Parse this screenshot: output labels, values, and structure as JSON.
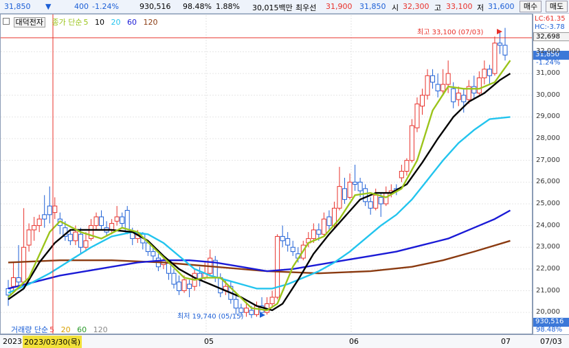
{
  "header": {
    "price": "31,850",
    "change_arrow": "▼",
    "change": "400",
    "change_pct": "-1.24%",
    "volume": "930,516",
    "ratio1": "98.48%",
    "ratio2": "1.88%",
    "amount": "30,015백만",
    "ask_label": "최우선",
    "ask": "31,900",
    "bid": "31,850",
    "open_label": "시",
    "open": "32,300",
    "high_label": "고",
    "high": "33,100",
    "low_label": "저",
    "low": "31,600",
    "buy_button": "매수",
    "sell_button": "매도"
  },
  "legend": {
    "stock_name": "대덕전자",
    "ma_label": "종가 단순",
    "ma5": "5",
    "ma10": "10",
    "ma20": "20",
    "ma60": "60",
    "ma120": "120"
  },
  "scale": {
    "lc": "LC:61.35",
    "hc": "HC:-3.78",
    "highlight_top": "32,698",
    "current": "31,850",
    "current_pct": "-1.24%",
    "ticks": [
      "32,000",
      "31,000",
      "30,000",
      "29,000",
      "28,000",
      "27,000",
      "26,000",
      "25,000",
      "24,000",
      "23,000",
      "22,000",
      "21,000",
      "20,000"
    ],
    "volume_box": "930,516",
    "volume_pct": "98.48%"
  },
  "annotations": {
    "high": "최고 33,100 (07/03)",
    "low": "최저 19,740 (05/15)"
  },
  "volume_legend": {
    "label": "거래량 단순",
    "ma5": "5",
    "ma20": "20",
    "ma60": "60",
    "ma120": "120"
  },
  "xaxis": {
    "year": "2023",
    "cursor_date": "2023/03/30(목)",
    "m05": "05",
    "m06": "06",
    "m07": "07",
    "right": "07/03"
  },
  "colors": {
    "up": "#e8302a",
    "down": "#1c5fd6",
    "ma5": "#9bc41a",
    "ma10": "#000000",
    "ma20": "#22c4ee",
    "ma60": "#1a1ad6",
    "ma120": "#8a3a10"
  },
  "chart_data": {
    "type": "candlestick",
    "ylim": [
      19500,
      33500
    ],
    "candles": [
      {
        "o": 21100,
        "c": 20800,
        "h": 21500,
        "l": 20300
      },
      {
        "o": 21200,
        "c": 21600,
        "h": 22300,
        "l": 21000
      },
      {
        "o": 21600,
        "c": 21400,
        "h": 23100,
        "l": 21200
      },
      {
        "o": 21400,
        "c": 23000,
        "h": 24800,
        "l": 21300
      },
      {
        "o": 23100,
        "c": 23800,
        "h": 24100,
        "l": 22800
      },
      {
        "o": 23800,
        "c": 24000,
        "h": 24400,
        "l": 23300
      },
      {
        "o": 24000,
        "c": 24300,
        "h": 24500,
        "l": 23700
      },
      {
        "o": 24500,
        "c": 24300,
        "h": 25400,
        "l": 23900
      },
      {
        "o": 24900,
        "c": 24500,
        "h": 25800,
        "l": 24100
      },
      {
        "o": 24600,
        "c": 24900,
        "h": 25300,
        "l": 24300
      },
      {
        "o": 24300,
        "c": 24000,
        "h": 24600,
        "l": 23600
      },
      {
        "o": 23900,
        "c": 23500,
        "h": 24200,
        "l": 23300
      },
      {
        "o": 23600,
        "c": 23300,
        "h": 23800,
        "l": 23100
      },
      {
        "o": 23300,
        "c": 23700,
        "h": 24000,
        "l": 23100
      },
      {
        "o": 23600,
        "c": 23000,
        "h": 23900,
        "l": 22700
      },
      {
        "o": 23000,
        "c": 23300,
        "h": 23700,
        "l": 22800
      },
      {
        "o": 23400,
        "c": 24000,
        "h": 24300,
        "l": 23300
      },
      {
        "o": 24000,
        "c": 24400,
        "h": 24600,
        "l": 23800
      },
      {
        "o": 24400,
        "c": 24000,
        "h": 24700,
        "l": 23800
      },
      {
        "o": 23900,
        "c": 23700,
        "h": 24200,
        "l": 23500
      },
      {
        "o": 23800,
        "c": 24100,
        "h": 24300,
        "l": 23600
      },
      {
        "o": 24200,
        "c": 24400,
        "h": 24900,
        "l": 24000
      },
      {
        "o": 24400,
        "c": 24100,
        "h": 24600,
        "l": 23900
      },
      {
        "o": 24700,
        "c": 23700,
        "h": 24900,
        "l": 23600
      },
      {
        "o": 23700,
        "c": 23400,
        "h": 23900,
        "l": 23100
      },
      {
        "o": 23400,
        "c": 23600,
        "h": 23800,
        "l": 23200
      },
      {
        "o": 23600,
        "c": 23200,
        "h": 23700,
        "l": 22900
      },
      {
        "o": 23200,
        "c": 22800,
        "h": 23300,
        "l": 22600
      },
      {
        "o": 22800,
        "c": 22600,
        "h": 23000,
        "l": 22400
      },
      {
        "o": 22500,
        "c": 22100,
        "h": 22700,
        "l": 21900
      },
      {
        "o": 22200,
        "c": 22400,
        "h": 22600,
        "l": 22000
      },
      {
        "o": 22300,
        "c": 21800,
        "h": 22400,
        "l": 21500
      },
      {
        "o": 21800,
        "c": 21300,
        "h": 22000,
        "l": 21100
      },
      {
        "o": 21400,
        "c": 21000,
        "h": 21700,
        "l": 20800
      },
      {
        "o": 21000,
        "c": 21500,
        "h": 21700,
        "l": 20900
      },
      {
        "o": 21300,
        "c": 21100,
        "h": 21500,
        "l": 20700
      },
      {
        "o": 21200,
        "c": 21800,
        "h": 22000,
        "l": 21000
      },
      {
        "o": 21800,
        "c": 21500,
        "h": 22100,
        "l": 21200
      },
      {
        "o": 21600,
        "c": 21800,
        "h": 22300,
        "l": 21500
      },
      {
        "o": 21800,
        "c": 22500,
        "h": 22900,
        "l": 21700
      },
      {
        "o": 22400,
        "c": 21600,
        "h": 22600,
        "l": 21400
      },
      {
        "o": 21600,
        "c": 20900,
        "h": 21800,
        "l": 20700
      },
      {
        "o": 21000,
        "c": 21200,
        "h": 21500,
        "l": 20800
      },
      {
        "o": 21200,
        "c": 20600,
        "h": 21400,
        "l": 20400
      },
      {
        "o": 20600,
        "c": 20200,
        "h": 20800,
        "l": 19900
      },
      {
        "o": 20200,
        "c": 20000,
        "h": 20400,
        "l": 19800
      },
      {
        "o": 20000,
        "c": 20200,
        "h": 20500,
        "l": 19800
      },
      {
        "o": 20100,
        "c": 19900,
        "h": 20300,
        "l": 19740
      },
      {
        "o": 19900,
        "c": 20300,
        "h": 20500,
        "l": 19800
      },
      {
        "o": 20300,
        "c": 20000,
        "h": 20700,
        "l": 19900
      },
      {
        "o": 20000,
        "c": 20400,
        "h": 20700,
        "l": 19900
      },
      {
        "o": 20400,
        "c": 20700,
        "h": 21000,
        "l": 20200
      },
      {
        "o": 20700,
        "c": 23500,
        "h": 23600,
        "l": 20600
      },
      {
        "o": 23500,
        "c": 23300,
        "h": 24000,
        "l": 23000
      },
      {
        "o": 23400,
        "c": 23100,
        "h": 23700,
        "l": 22800
      },
      {
        "o": 23000,
        "c": 22800,
        "h": 23300,
        "l": 22600
      },
      {
        "o": 22700,
        "c": 22500,
        "h": 23000,
        "l": 22300
      },
      {
        "o": 22500,
        "c": 23100,
        "h": 23300,
        "l": 22400
      },
      {
        "o": 23200,
        "c": 23400,
        "h": 23700,
        "l": 23000
      },
      {
        "o": 23400,
        "c": 23800,
        "h": 24100,
        "l": 23200
      },
      {
        "o": 23800,
        "c": 23600,
        "h": 24100,
        "l": 23300
      },
      {
        "o": 23600,
        "c": 24300,
        "h": 24600,
        "l": 23500
      },
      {
        "o": 24400,
        "c": 24000,
        "h": 24700,
        "l": 23800
      },
      {
        "o": 24000,
        "c": 24800,
        "h": 25100,
        "l": 23900
      },
      {
        "o": 24800,
        "c": 25800,
        "h": 26700,
        "l": 24700
      },
      {
        "o": 25700,
        "c": 25200,
        "h": 26200,
        "l": 25000
      },
      {
        "o": 25300,
        "c": 26000,
        "h": 26400,
        "l": 25200
      },
      {
        "o": 26000,
        "c": 25900,
        "h": 26800,
        "l": 25600
      },
      {
        "o": 26000,
        "c": 25600,
        "h": 26200,
        "l": 25300
      },
      {
        "o": 25700,
        "c": 25100,
        "h": 25900,
        "l": 24900
      },
      {
        "o": 25100,
        "c": 24800,
        "h": 25300,
        "l": 24500
      },
      {
        "o": 24800,
        "c": 25400,
        "h": 25700,
        "l": 24700
      },
      {
        "o": 25300,
        "c": 25000,
        "h": 25500,
        "l": 24400
      },
      {
        "o": 25000,
        "c": 25500,
        "h": 25800,
        "l": 24900
      },
      {
        "o": 25500,
        "c": 25600,
        "h": 25900,
        "l": 25300
      },
      {
        "o": 25700,
        "c": 25600,
        "h": 25900,
        "l": 25400
      },
      {
        "o": 26200,
        "c": 26500,
        "h": 26800,
        "l": 26000
      },
      {
        "o": 26500,
        "c": 27000,
        "h": 27100,
        "l": 26300
      },
      {
        "o": 27000,
        "c": 28600,
        "h": 28900,
        "l": 26900
      },
      {
        "o": 28500,
        "c": 29600,
        "h": 29900,
        "l": 28300
      },
      {
        "o": 29500,
        "c": 30000,
        "h": 30300,
        "l": 29100
      },
      {
        "o": 30000,
        "c": 30900,
        "h": 31200,
        "l": 29800
      },
      {
        "o": 30900,
        "c": 30600,
        "h": 31200,
        "l": 30300
      },
      {
        "o": 30500,
        "c": 30200,
        "h": 31000,
        "l": 29900
      },
      {
        "o": 30200,
        "c": 30500,
        "h": 31200,
        "l": 30000
      },
      {
        "o": 30500,
        "c": 31000,
        "h": 31600,
        "l": 30100
      },
      {
        "o": 30300,
        "c": 29700,
        "h": 30600,
        "l": 29400
      },
      {
        "o": 29800,
        "c": 30100,
        "h": 30400,
        "l": 29500
      },
      {
        "o": 30000,
        "c": 29700,
        "h": 30300,
        "l": 29200
      },
      {
        "o": 29800,
        "c": 30400,
        "h": 30700,
        "l": 29600
      },
      {
        "o": 30400,
        "c": 30100,
        "h": 30900,
        "l": 29800
      },
      {
        "o": 30100,
        "c": 30800,
        "h": 31100,
        "l": 30000
      },
      {
        "o": 30800,
        "c": 31200,
        "h": 31600,
        "l": 30500
      },
      {
        "o": 31200,
        "c": 30900,
        "h": 31400,
        "l": 30500
      },
      {
        "o": 31000,
        "c": 32400,
        "h": 32700,
        "l": 30900
      },
      {
        "o": 32400,
        "c": 32300,
        "h": 32900,
        "l": 31900
      },
      {
        "o": 32300,
        "c": 31850,
        "h": 33100,
        "l": 31600
      }
    ],
    "ma5": [
      [
        0,
        20700
      ],
      [
        4,
        21600
      ],
      [
        8,
        23700
      ],
      [
        10,
        24200
      ],
      [
        14,
        23700
      ],
      [
        18,
        23400
      ],
      [
        22,
        23900
      ],
      [
        25,
        23700
      ],
      [
        28,
        23000
      ],
      [
        31,
        22300
      ],
      [
        34,
        21600
      ],
      [
        36,
        21500
      ],
      [
        38,
        21600
      ],
      [
        41,
        21600
      ],
      [
        44,
        20900
      ],
      [
        47,
        20200
      ],
      [
        50,
        20100
      ],
      [
        52,
        20400
      ],
      [
        55,
        22100
      ],
      [
        58,
        23200
      ],
      [
        61,
        23500
      ],
      [
        64,
        24300
      ],
      [
        67,
        25400
      ],
      [
        70,
        25500
      ],
      [
        73,
        25300
      ],
      [
        76,
        25700
      ],
      [
        79,
        27000
      ],
      [
        82,
        29300
      ],
      [
        85,
        30400
      ],
      [
        88,
        30300
      ],
      [
        91,
        30300
      ],
      [
        94,
        30600
      ],
      [
        97,
        31600
      ]
    ],
    "ma10": [
      [
        0,
        20600
      ],
      [
        3,
        21100
      ],
      [
        6,
        22300
      ],
      [
        9,
        23200
      ],
      [
        12,
        23800
      ],
      [
        16,
        23800
      ],
      [
        20,
        23800
      ],
      [
        24,
        23700
      ],
      [
        27,
        23300
      ],
      [
        30,
        22600
      ],
      [
        33,
        22000
      ],
      [
        36,
        21600
      ],
      [
        39,
        21300
      ],
      [
        42,
        21000
      ],
      [
        45,
        20700
      ],
      [
        48,
        20300
      ],
      [
        51,
        20100
      ],
      [
        53,
        20400
      ],
      [
        56,
        21500
      ],
      [
        59,
        22700
      ],
      [
        62,
        23600
      ],
      [
        65,
        24400
      ],
      [
        68,
        25200
      ],
      [
        71,
        25500
      ],
      [
        74,
        25500
      ],
      [
        77,
        25900
      ],
      [
        80,
        26900
      ],
      [
        83,
        28000
      ],
      [
        86,
        29000
      ],
      [
        89,
        29700
      ],
      [
        92,
        30100
      ],
      [
        95,
        30700
      ],
      [
        97,
        31000
      ]
    ],
    "ma20": [
      [
        0,
        20900
      ],
      [
        4,
        21300
      ],
      [
        8,
        21800
      ],
      [
        12,
        22400
      ],
      [
        16,
        23000
      ],
      [
        20,
        23500
      ],
      [
        24,
        23700
      ],
      [
        27,
        23600
      ],
      [
        30,
        23200
      ],
      [
        33,
        22600
      ],
      [
        36,
        22000
      ],
      [
        39,
        21700
      ],
      [
        42,
        21500
      ],
      [
        45,
        21300
      ],
      [
        48,
        21100
      ],
      [
        51,
        21100
      ],
      [
        54,
        21300
      ],
      [
        57,
        21600
      ],
      [
        60,
        21900
      ],
      [
        63,
        22300
      ],
      [
        66,
        22800
      ],
      [
        69,
        23400
      ],
      [
        72,
        24000
      ],
      [
        75,
        24500
      ],
      [
        78,
        25200
      ],
      [
        81,
        26100
      ],
      [
        84,
        27000
      ],
      [
        87,
        27800
      ],
      [
        90,
        28400
      ],
      [
        93,
        28900
      ],
      [
        97,
        29000
      ]
    ],
    "ma60": [
      [
        0,
        21100
      ],
      [
        5,
        21400
      ],
      [
        10,
        21700
      ],
      [
        15,
        21900
      ],
      [
        20,
        22100
      ],
      [
        25,
        22300
      ],
      [
        30,
        22400
      ],
      [
        35,
        22400
      ],
      [
        40,
        22300
      ],
      [
        45,
        22100
      ],
      [
        50,
        21900
      ],
      [
        55,
        22000
      ],
      [
        60,
        22200
      ],
      [
        65,
        22400
      ],
      [
        70,
        22600
      ],
      [
        75,
        22800
      ],
      [
        80,
        23100
      ],
      [
        85,
        23400
      ],
      [
        90,
        23900
      ],
      [
        94,
        24300
      ],
      [
        97,
        24700
      ]
    ],
    "ma120": [
      [
        0,
        22300
      ],
      [
        10,
        22400
      ],
      [
        20,
        22400
      ],
      [
        30,
        22300
      ],
      [
        40,
        22100
      ],
      [
        50,
        21900
      ],
      [
        60,
        21800
      ],
      [
        70,
        21900
      ],
      [
        78,
        22100
      ],
      [
        84,
        22400
      ],
      [
        90,
        22800
      ],
      [
        97,
        23300
      ]
    ]
  }
}
